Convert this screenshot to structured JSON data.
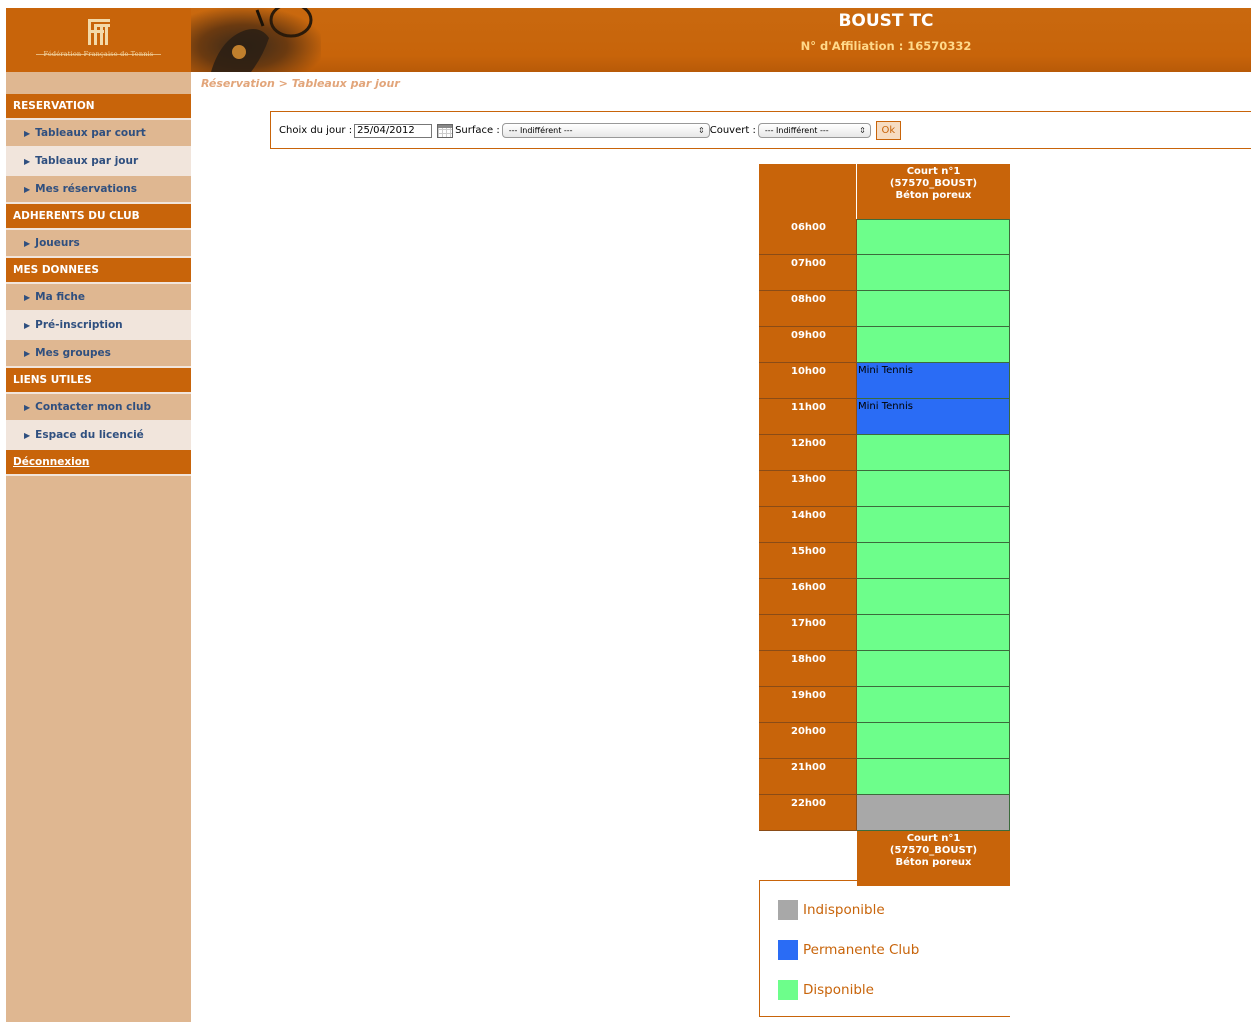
{
  "header": {
    "logo_caption": "Fédération Française de Tennis",
    "club_name": "BOUST TC",
    "affiliation": "N° d'Affiliation : 16570332"
  },
  "sidebar": {
    "sections": [
      {
        "title": "RESERVATION",
        "items": [
          {
            "label": "Tableaux par court",
            "shade": "dark"
          },
          {
            "label": "Tableaux par jour",
            "shade": "light"
          },
          {
            "label": "Mes réservations",
            "shade": "dark"
          }
        ]
      },
      {
        "title": "ADHERENTS DU CLUB",
        "items": [
          {
            "label": "Joueurs",
            "shade": "dark"
          }
        ]
      },
      {
        "title": "MES DONNEES",
        "items": [
          {
            "label": "Ma fiche",
            "shade": "dark"
          },
          {
            "label": "Pré-inscription",
            "shade": "light"
          },
          {
            "label": "Mes groupes",
            "shade": "dark"
          }
        ]
      },
      {
        "title": "LIENS UTILES",
        "items": [
          {
            "label": "Contacter mon club",
            "shade": "dark"
          },
          {
            "label": "Espace du licencié",
            "shade": "light"
          }
        ]
      }
    ],
    "logout": "Déconnexion"
  },
  "breadcrumb": "Réservation > Tableaux par jour",
  "filters": {
    "date_label": "Choix du jour :",
    "date_value": "25/04/2012",
    "surface_label": "Surface :",
    "surface_value": "--- Indifférent ---",
    "couvert_label": "Couvert :",
    "couvert_value": "--- Indifférent ---",
    "ok": "Ok"
  },
  "court": {
    "line1": "Court n°1",
    "line2": "(57570_BOUST)",
    "line3": "Béton poreux"
  },
  "colors": {
    "Indisponible": "#a8a8a8",
    "Permanente Club": "#2a6cf5",
    "Disponible": "#6dfe8b"
  },
  "slots": [
    {
      "time": "06h00",
      "status": "Disponible",
      "text": ""
    },
    {
      "time": "07h00",
      "status": "Disponible",
      "text": ""
    },
    {
      "time": "08h00",
      "status": "Disponible",
      "text": ""
    },
    {
      "time": "09h00",
      "status": "Disponible",
      "text": ""
    },
    {
      "time": "10h00",
      "status": "Permanente Club",
      "text": "Mini Tennis"
    },
    {
      "time": "11h00",
      "status": "Permanente Club",
      "text": "Mini Tennis"
    },
    {
      "time": "12h00",
      "status": "Disponible",
      "text": ""
    },
    {
      "time": "13h00",
      "status": "Disponible",
      "text": ""
    },
    {
      "time": "14h00",
      "status": "Disponible",
      "text": ""
    },
    {
      "time": "15h00",
      "status": "Disponible",
      "text": ""
    },
    {
      "time": "16h00",
      "status": "Disponible",
      "text": ""
    },
    {
      "time": "17h00",
      "status": "Disponible",
      "text": ""
    },
    {
      "time": "18h00",
      "status": "Disponible",
      "text": ""
    },
    {
      "time": "19h00",
      "status": "Disponible",
      "text": ""
    },
    {
      "time": "20h00",
      "status": "Disponible",
      "text": ""
    },
    {
      "time": "21h00",
      "status": "Disponible",
      "text": ""
    },
    {
      "time": "22h00",
      "status": "Indisponible",
      "text": ""
    }
  ],
  "legend": [
    "Indisponible",
    "Permanente Club",
    "Disponible"
  ]
}
